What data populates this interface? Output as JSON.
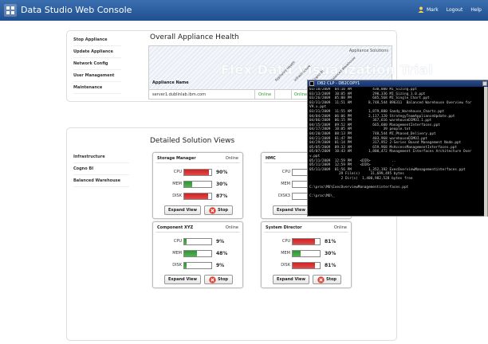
{
  "app": {
    "title": "Data Studio Web Console"
  },
  "header": {
    "user": "Mark",
    "logout": "Logout",
    "help": "Help"
  },
  "nav_top": [
    {
      "label": "Stop Appliance"
    },
    {
      "label": "Update Appliance"
    },
    {
      "label": "Network Config"
    },
    {
      "label": "User Management"
    },
    {
      "label": "Maintenance"
    }
  ],
  "nav_bottom": [
    {
      "label": "Infrastructure"
    },
    {
      "label": "Cogno BI"
    },
    {
      "label": "Balanced Warehouse"
    }
  ],
  "health": {
    "title": "Overall Appliance Health",
    "solutions_label": "Appliance Solutions",
    "watermark": "Flex Data Visualization Trial",
    "name_header": "Appliance Name",
    "columns": [
      "Appliance Health",
      "Infrastructure",
      "Cogno BI",
      "Balanced Warehouse"
    ],
    "row": {
      "name": "server1.dublinlab.ibm.com",
      "status1": "Online",
      "status2": "Online"
    }
  },
  "solutions": {
    "title": "Detailed Solution Views",
    "cards": [
      {
        "title": "Storage Manager",
        "status": "Online",
        "metrics": [
          {
            "label": "CPU",
            "value": 90,
            "text": "90%",
            "color": "#d42020"
          },
          {
            "label": "MEM",
            "value": 30,
            "text": "30%",
            "color": "#2a9a2a"
          },
          {
            "label": "DISK",
            "value": 87,
            "text": "87%",
            "color": "#d42020"
          }
        ]
      },
      {
        "title": "HMC",
        "status": "",
        "metrics": [
          {
            "label": "CPU",
            "value": 0,
            "text": "",
            "color": "#2a9a2a"
          },
          {
            "label": "MEM",
            "value": 0,
            "text": "",
            "color": "#2a9a2a"
          },
          {
            "label": "DISK3",
            "value": 0,
            "text": "",
            "color": "#2a9a2a"
          }
        ]
      },
      {
        "title": "Component XYZ",
        "status": "Online",
        "metrics": [
          {
            "label": "CPU",
            "value": 9,
            "text": "9%",
            "color": "#2a9a2a"
          },
          {
            "label": "MEM",
            "value": 48,
            "text": "48%",
            "color": "#2a9a2a"
          },
          {
            "label": "DISK",
            "value": 9,
            "text": "9%",
            "color": "#2a9a2a"
          }
        ]
      },
      {
        "title": "System Director",
        "status": "Online",
        "metrics": [
          {
            "label": "CPU",
            "value": 81,
            "text": "81%",
            "color": "#d42020"
          },
          {
            "label": "MEM",
            "value": 30,
            "text": "30%",
            "color": "#2a9a2a"
          },
          {
            "label": "DISK",
            "value": 81,
            "text": "81%",
            "color": "#d42020"
          }
        ]
      }
    ],
    "expand_label": "Expand View",
    "stop_label": "Stop"
  },
  "terminal": {
    "title": "DB2 CLP - DB2COPY1",
    "lines": [
      "03/18/2009  04:10 AM          430,080 MI_Sizing.ppt",
      "03/13/2009  10:05 AM          290,336 MI_Sizing_1.0.ppt",
      "03/26/2009  05:00 PM          685,568 MI_Single_Chart.ppt",
      "03/31/2009  11:51 AM        8,748,544 096311  Balanced Warehouse Overview for",
      "V9.x.ppt",
      "03/31/2009  11:55 AM        1,879,880 Sandy_Warehouse_Charts.ppt",
      "04/04/2009  06:06 PM        2,117,120 StrategyTeamApplianceUpdate.ppt",
      "04/06/2009  06:15 PM          367,616 warehouseDIMOI.1.ppt",
      "04/15/2009  09:52 AM          665,600 ManagementInterfaces.ppt",
      "04/17/2009  10:05 AM               39 people.txt",
      "04/20/2009  08:13 PM          748,544 MI_Phased_Delivery.ppt",
      "04/21/2009  01:47 PM          403,968 warehouseDIMOI.ppt",
      "04/29/2009  01:14 PM          317,952 2-Series Based Management Node.ppt",
      "05/05/2009  09:33 AM          659,968 MsAccessManagementInterfaces.ppt",
      "05/07/2009  10:43 AM        1,800,472 Management Interfaces Architecture Over",
      "v.ppt",
      "05/11/2009  12:59 PM    <DIR>          ..",
      "05/11/2009  12:59 PM    <DIR>          .",
      "05/11/2009  01:56 PM        1,352,192 ExecOverviewManagementinterfaces.ppt",
      "              29 File(s)     31,699,495 bytes",
      "               2 Dir(s)  1,400,982,528 bytes free",
      "",
      "C:\\proc\\MU\\ExecOverviewManagementinterfaces.ppt",
      "",
      "C:\\proc\\MU\\_"
    ]
  }
}
